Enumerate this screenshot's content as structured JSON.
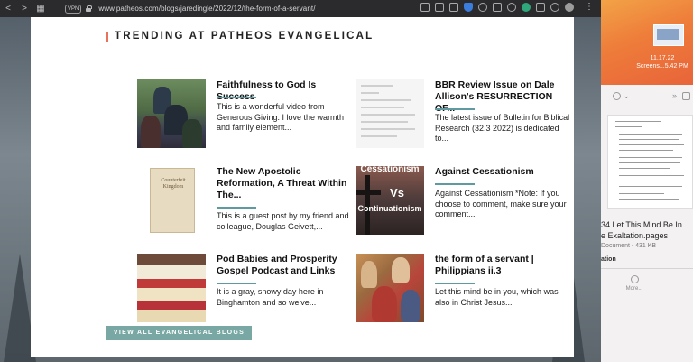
{
  "browser": {
    "url": "www.patheos.com/blogs/jaredingle/2022/12/the-form-of-a-servant/",
    "vpn_label": "VPN",
    "nav": {
      "back": "<",
      "forward": ">",
      "grid": "▦"
    },
    "menu": "⋮"
  },
  "section": {
    "title": "TRENDING AT PATHEOS EVANGELICAL"
  },
  "articles": [
    {
      "title": "Faithfulness to God Is Success",
      "excerpt": "This is a wonderful video from Generous Giving. I love the warmth and family element..."
    },
    {
      "title": "BBR Review Issue on Dale Allison's RESURRECTION OF...",
      "excerpt": "The latest issue of Bulletin for Biblical Research (32.3 2022) is dedicated to..."
    },
    {
      "title": "The New Apostolic Reformation, A Threat Within The...",
      "excerpt": "This is a guest post by my friend and colleague, Douglas Geivett,...",
      "thumb_text": "Counterfeit Kingdom"
    },
    {
      "title": "Against Cessationism",
      "excerpt": "Against Cessationism *Note: If you choose to comment, make sure your comment...",
      "thumb_text_1": "Cessationism",
      "thumb_text_2": "Vs",
      "thumb_text_3": "Continuationism"
    },
    {
      "title": "Pod Babies and Prosperity Gospel Podcast and Links",
      "excerpt": "It is a gray, snowy day here in Binghamton and so we've..."
    },
    {
      "title": "the form of a servant | Philippians ii.3",
      "excerpt": "Let this mind be in you, which was also in Christ Jesus..."
    }
  ],
  "view_all_label": "VIEW ALL EVANGELICAL BLOGS",
  "desktop": {
    "screenshot_label": "11.17.22\nScreens...5.42 PM"
  },
  "file_panel": {
    "header": "⌄",
    "chevrons": "»",
    "file_name": "34 Let This Mind Be In",
    "file_name_2": "e Exaltation.pages",
    "file_meta": "Document - 431 KB",
    "file_loc": "ation",
    "more_label": "More..."
  },
  "colors": {
    "accent_bar": "#e8725a",
    "rule": "#5f9aa0",
    "button": "#79a7a3"
  }
}
